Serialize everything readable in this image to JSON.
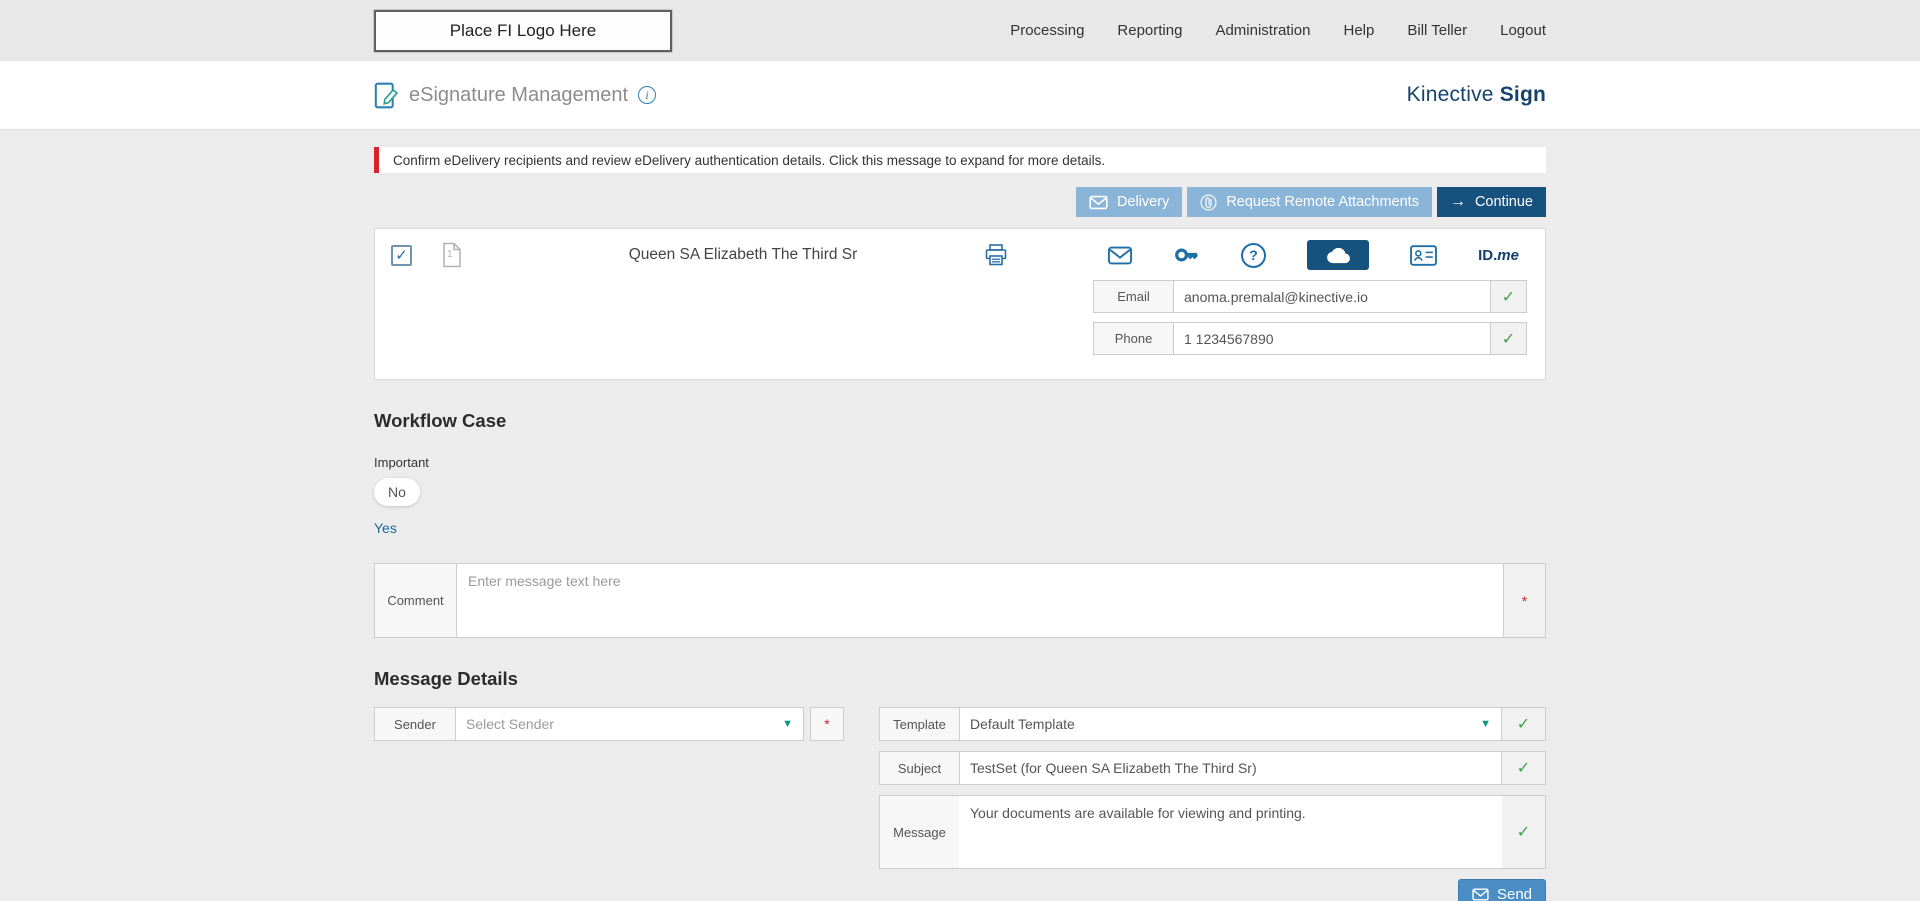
{
  "topbar": {
    "logo_placeholder": "Place FI Logo Here",
    "nav": [
      {
        "label": "Processing"
      },
      {
        "label": "Reporting"
      },
      {
        "label": "Administration"
      },
      {
        "label": "Help"
      },
      {
        "label": "Bill Teller"
      },
      {
        "label": "Logout"
      }
    ]
  },
  "header": {
    "title": "eSignature Management",
    "brand": {
      "name": "Kinective ",
      "product": "Sign"
    }
  },
  "alert": {
    "message": "Confirm eDelivery recipients and review eDelivery authentication details. Click this message to expand for more details."
  },
  "toolbar": {
    "delivery_label": "Delivery",
    "request_remote_attachments_label": "Request Remote Attachments",
    "continue_label": "Continue"
  },
  "recipient": {
    "name": "Queen SA Elizabeth The Third Sr",
    "doc_count": "1",
    "auth_methods": [
      "email",
      "password",
      "security-question",
      "cloud-delivery",
      "id-card",
      "idme"
    ],
    "selected_auth": "cloud-delivery",
    "idme": {
      "bold": "ID.",
      "italic": "me"
    },
    "email": {
      "label": "Email",
      "value": "anoma.premalal@kinective.io"
    },
    "phone": {
      "label": "Phone",
      "value": "1 1234567890"
    }
  },
  "workflow_case": {
    "heading": "Workflow Case",
    "important_label": "Important",
    "option_no": "No",
    "option_yes": "Yes",
    "comment": {
      "label": "Comment",
      "placeholder": "Enter message text here",
      "required_marker": "*"
    }
  },
  "message_details": {
    "heading": "Message Details",
    "sender": {
      "label": "Sender",
      "placeholder": "Select Sender",
      "required_marker": "*"
    },
    "template": {
      "label": "Template",
      "value": "Default Template"
    },
    "subject": {
      "label": "Subject",
      "value": "TestSet (for Queen SA Elizabeth The Third Sr)"
    },
    "message": {
      "label": "Message",
      "value": "Your documents are available for viewing and printing."
    },
    "send_label": "Send"
  },
  "symbols": {
    "check": "✓",
    "dropdown_arrow": "▼",
    "continue_arrow": "→"
  },
  "colors": {
    "brand_navy": "#16436b",
    "action_dark_blue": "#17517e",
    "action_light_blue": "#8ab5d8",
    "send_blue": "#4b8ec6",
    "success_green": "#43a047",
    "dropdown_teal": "#0a9688",
    "alert_red": "#d8232a",
    "required_red": "#cf2030"
  }
}
